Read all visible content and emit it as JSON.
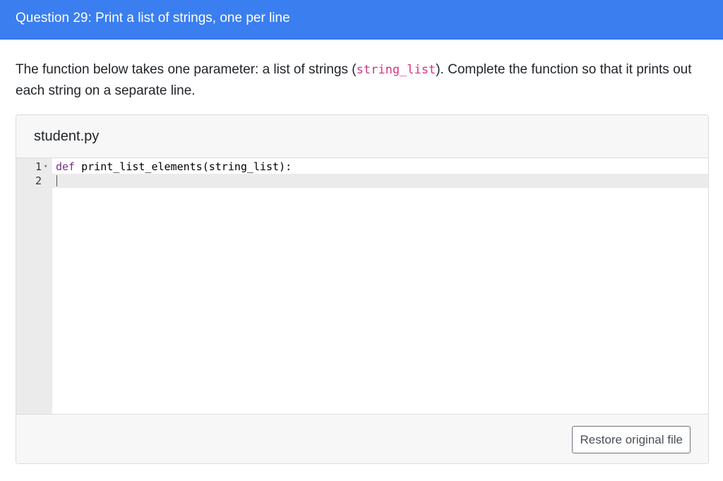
{
  "header": {
    "title": "Question 29: Print a list of strings, one per line"
  },
  "prompt": {
    "text_before": "The function below takes one parameter: a list of strings (",
    "code": "string_list",
    "text_after": "). Complete the function so that it prints out each string on a separate line."
  },
  "editor": {
    "filename": "student.py",
    "lines": [
      {
        "number": "1",
        "keyword": "def",
        "code": " print_list_elements(string_list):"
      },
      {
        "number": "2",
        "keyword": "",
        "code": ""
      }
    ]
  },
  "footer": {
    "restore_label": "Restore original file"
  },
  "colors": {
    "header_bg": "#3a7ef0",
    "inline_code": "#d63384",
    "keyword": "#7b2d8a"
  }
}
